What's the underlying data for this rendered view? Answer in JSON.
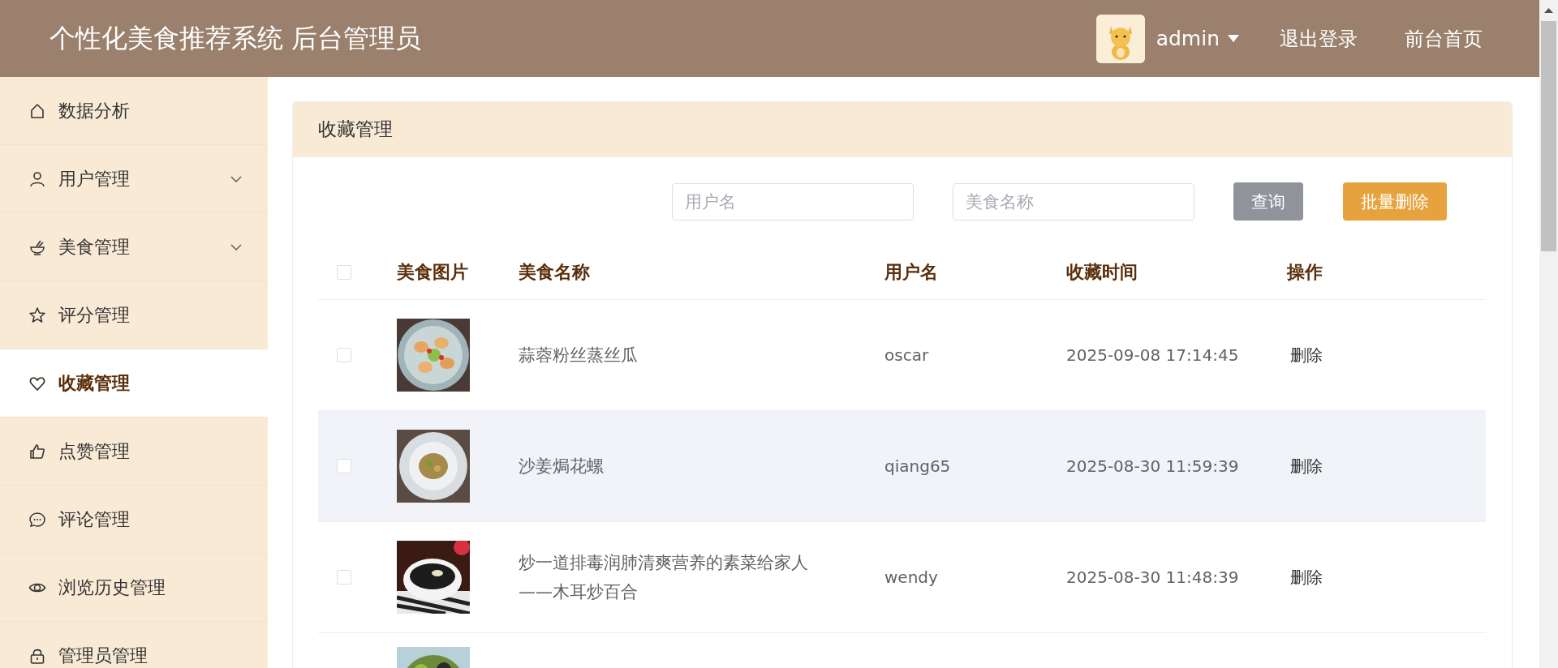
{
  "header": {
    "title": "个性化美食推荐系统 后台管理员",
    "user": {
      "name": "admin"
    },
    "links": [
      "退出登录",
      "前台首页"
    ]
  },
  "sidebar": {
    "items": [
      {
        "label": "数据分析",
        "expandable": false,
        "selected": false
      },
      {
        "label": "用户管理",
        "expandable": true,
        "selected": false
      },
      {
        "label": "美食管理",
        "expandable": true,
        "selected": false
      },
      {
        "label": "评分管理",
        "expandable": false,
        "selected": false
      },
      {
        "label": "收藏管理",
        "expandable": false,
        "selected": true
      },
      {
        "label": "点赞管理",
        "expandable": false,
        "selected": false
      },
      {
        "label": "评论管理",
        "expandable": false,
        "selected": false
      },
      {
        "label": "浏览历史管理",
        "expandable": false,
        "selected": false
      },
      {
        "label": "管理员管理",
        "expandable": false,
        "selected": false
      }
    ]
  },
  "card": {
    "title": "收藏管理",
    "search": {
      "fields": [
        {
          "placeholder": "用户名"
        },
        {
          "placeholder": "美食名称"
        }
      ],
      "buttons": [
        {
          "label": "查询",
          "kind": "query"
        },
        {
          "label": "批量删除",
          "kind": "batch-delete"
        }
      ]
    },
    "table": {
      "select_all": {
        "checked": false
      },
      "columns": [
        "美食图片",
        "美食名称",
        "用户名",
        "收藏时间",
        "操作"
      ],
      "rows": [
        {
          "checked": false,
          "highlighted": false,
          "image": {
            "kind": "picture"
          },
          "name": "蒜蓉粉丝蒸丝瓜",
          "user": "oscar",
          "time": "2025-09-08 17:14:45",
          "action": "删除"
        },
        {
          "checked": false,
          "highlighted": true,
          "image": {
            "kind": "picture"
          },
          "name": "沙姜焗花螺",
          "user": "qiang65",
          "time": "2025-08-30 11:59:39",
          "action": "删除"
        },
        {
          "checked": false,
          "highlighted": false,
          "image": {
            "kind": "picture"
          },
          "name": "炒一道排毒润肺清爽营养的素菜给家人——木耳炒百合",
          "user": "wendy",
          "time": "2025-08-30 11:48:39",
          "action": "删除"
        },
        {
          "image": {
            "kind": "picture"
          }
        }
      ]
    }
  }
}
